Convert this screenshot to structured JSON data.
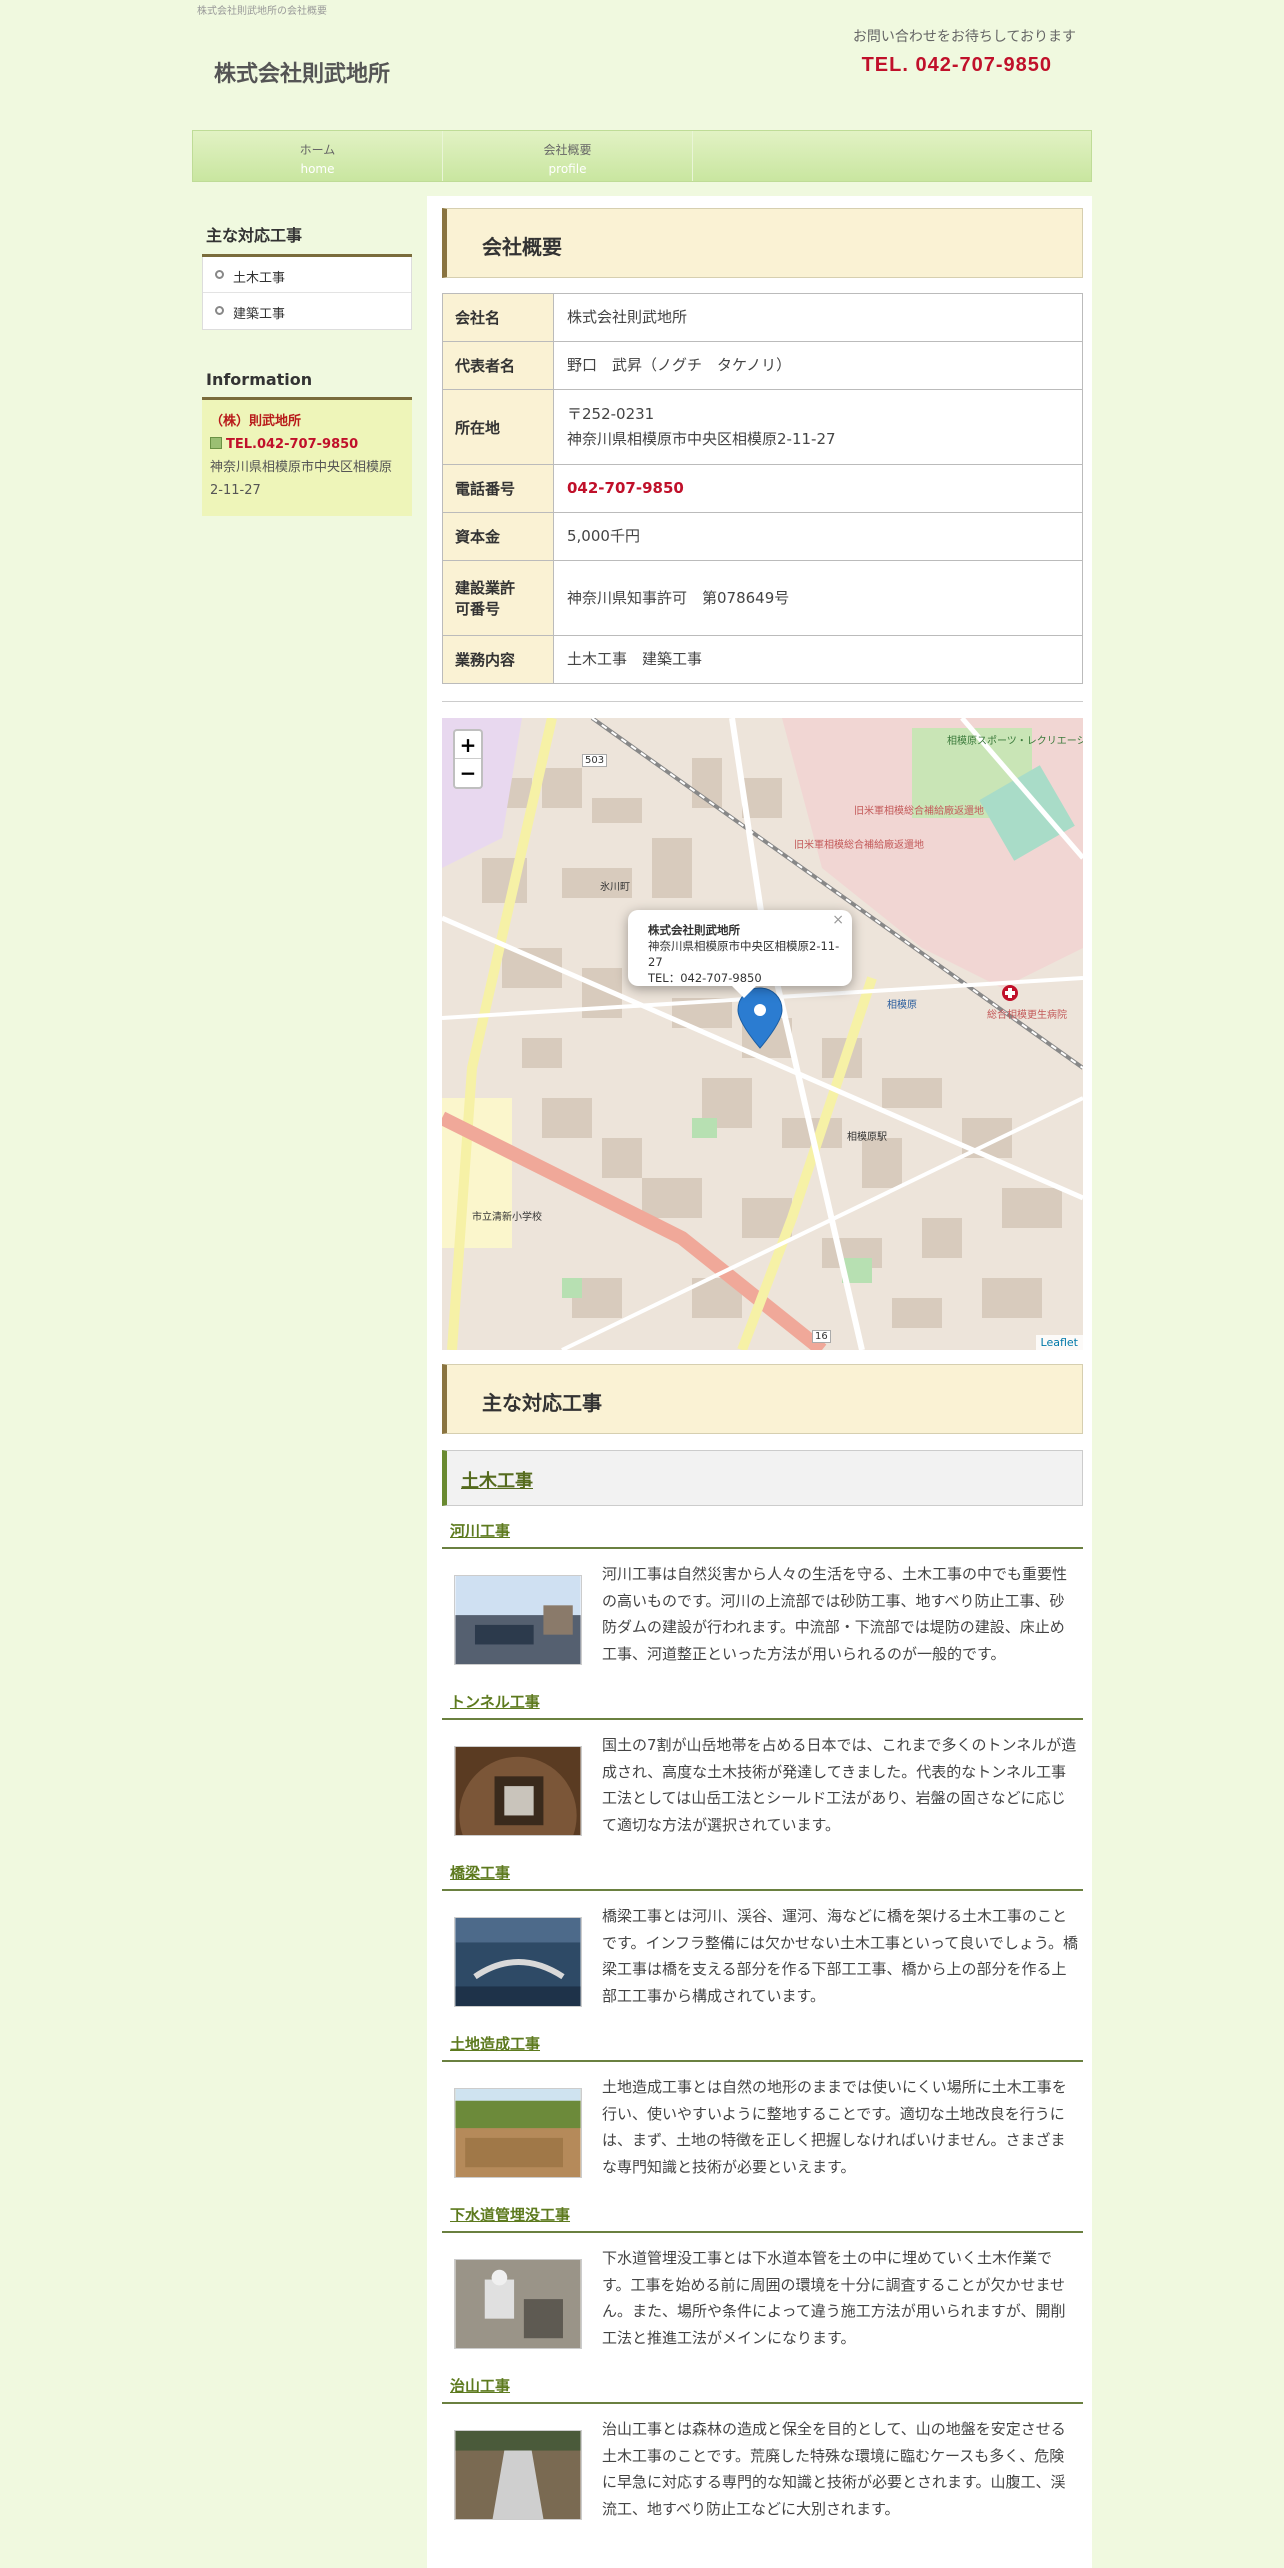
{
  "header": {
    "tagline": "株式会社則武地所の会社概要",
    "logo": "株式会社則武地所",
    "contact_msg": "お問い合わせをお待ちしております",
    "tel": "TEL. 042-707-9850"
  },
  "nav": [
    {
      "jp": "ホーム",
      "en": "home"
    },
    {
      "jp": "会社概要",
      "en": "profile"
    }
  ],
  "sidebar": {
    "menu_title": "主な対応工事",
    "menu": [
      "土木工事",
      "建築工事"
    ],
    "info_title": "Information",
    "company": "（株）則武地所",
    "tel": "TEL.042-707-9850",
    "address": "神奈川県相模原市中央区相模原2-11-27"
  },
  "profile": {
    "title": "会社概要",
    "rows": [
      {
        "label": "会社名",
        "value": "株式会社則武地所"
      },
      {
        "label": "代表者名",
        "value": "野口　武昇（ノグチ　タケノリ）"
      },
      {
        "label": "所在地",
        "value_line1": "〒252-0231",
        "value_line2": "神奈川県相模原市中央区相模原2-11-27"
      },
      {
        "label": "電話番号",
        "value": "042-707-9850"
      },
      {
        "label": "資本金",
        "value": "5,000千円"
      },
      {
        "label_line1": "建設業許",
        "label_line2": "可番号",
        "value": "神奈川県知事許可　第078649号"
      },
      {
        "label": "業務内容",
        "value": "土木工事　建築工事"
      }
    ]
  },
  "map": {
    "zoom_in": "+",
    "zoom_out": "−",
    "popup_name": "株式会社則武地所",
    "popup_address": "神奈川県相模原市中央区相模原2-11-27",
    "popup_tel": "TEL：042-707-9850",
    "popup_close": "×",
    "attribution": "Leaflet",
    "labels": {
      "sports_park": "相模原スポーツ・レクリエーションパーク",
      "camp1": "旧米軍相模総合補給廠返還地",
      "camp2": "旧米軍相模総合補給廠返還地",
      "station": "相模原",
      "hospital": "総合相模更生病院",
      "hikawa": "氷川町",
      "school": "市立清新小学校",
      "sagamihara_st": "相模原駅",
      "road503": "503",
      "road16": "16"
    }
  },
  "works": {
    "title": "主な対応工事",
    "subtitle": "土木工事",
    "items": [
      {
        "name": "河川工事",
        "text": "河川工事は自然災害から人々の生活を守る、土木工事の中でも重要性の高いものです。河川の上流部では砂防工事、地すべり防止工事、砂防ダムの建設が行われます。中流部・下流部では堤防の建設、床止め工事、河道整正といった方法が用いられるのが一般的です。"
      },
      {
        "name": "トンネル工事",
        "text": "国土の7割が山岳地帯を占める日本では、これまで多くのトンネルが造成され、高度な土木技術が発達してきました。代表的なトンネル工事工法としては山岳工法とシールド工法があり、岩盤の固さなどに応じて適切な方法が選択されています。"
      },
      {
        "name": "橋梁工事",
        "text": "橋梁工事とは河川、渓谷、運河、海などに橋を架ける土木工事のことです。インフラ整備には欠かせない土木工事といって良いでしょう。橋梁工事は橋を支える部分を作る下部工工事、橋から上の部分を作る上部工工事から構成されています。"
      },
      {
        "name": "土地造成工事",
        "text": "土地造成工事とは自然の地形のままでは使いにくい場所に土木工事を行い、使いやすいように整地することです。適切な土地改良を行うには、まず、土地の特徴を正しく把握しなければいけません。さまざまな専門知識と技術が必要といえます。"
      },
      {
        "name": "下水道管埋没工事",
        "text": "下水道管埋没工事とは下水道本管を土の中に埋めていく土木作業です。工事を始める前に周囲の環境を十分に調査することが欠かせません。また、場所や条件によって違う施工方法が用いられますが、開削工法と推進工法がメインになります。"
      },
      {
        "name": "治山工事",
        "text": "治山工事とは森林の造成と保全を目的として、山の地盤を安定させる土木工事のことです。荒廃した特殊な環境に臨むケースも多く、危険に早急に対応する専門的な知識と技術が必要とされます。山腹工、渓流工、地すべり防止工などに大別されます。"
      }
    ]
  }
}
